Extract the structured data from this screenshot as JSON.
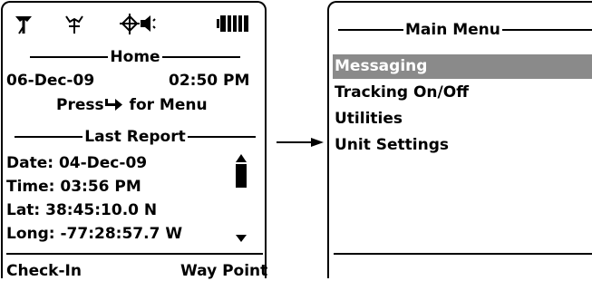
{
  "home": {
    "header_title": "Home",
    "date": "06-Dec-09",
    "time": "02:50 PM",
    "press_prefix": "Press",
    "press_suffix": "for Menu",
    "last_report_title": "Last Report",
    "report": {
      "date": "Date: 04-Dec-09",
      "time": "Time: 03:56 PM",
      "lat": "Lat: 38:45:10.0 N",
      "long": "Long: -77:28:57.7 W"
    },
    "softkey_left": "Check-In",
    "softkey_right": "Way Point"
  },
  "status_icons": [
    "gps-antenna-icon",
    "satellite-antenna-icon",
    "crosshair-icon",
    "speaker-icon",
    "battery-icon"
  ],
  "menu": {
    "title": "Main Menu",
    "items": [
      {
        "label": "Messaging",
        "selected": true
      },
      {
        "label": "Tracking On/Off",
        "selected": false
      },
      {
        "label": "Utilities",
        "selected": false
      },
      {
        "label": "Unit Settings",
        "selected": false
      }
    ]
  },
  "colors": {
    "selection_bg": "#8a8a8a",
    "selection_fg": "#ffffff",
    "ink": "#000000"
  }
}
